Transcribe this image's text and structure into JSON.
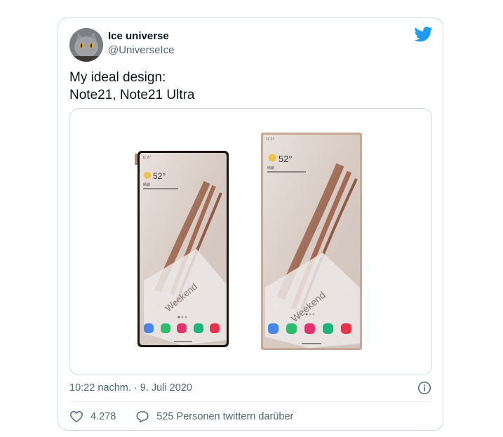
{
  "author": {
    "name": "Ice universe",
    "handle": "@UniverseIce"
  },
  "tweet": {
    "text": "My ideal design:\nNote21, Note21 Ultra"
  },
  "media": {
    "phones": [
      {
        "time": "11:27",
        "temperature": "52°",
        "widget_caption": "晴朗",
        "brand_text": "Weekend",
        "dock_colors": [
          "#4a86e8",
          "#2ebd6b",
          "#e0336f",
          "#20b37c",
          "#e8344a"
        ]
      },
      {
        "time": "11:27",
        "temperature": "52°",
        "widget_caption": "晴朗",
        "brand_text": "Weekend",
        "dock_colors": [
          "#4a86e8",
          "#2ebd6b",
          "#e0336f",
          "#20b37c",
          "#e8344a"
        ]
      }
    ]
  },
  "meta": {
    "timestamp": "10:22 nachm. · 9. Juli 2020"
  },
  "stats": {
    "likes": "4.278",
    "retweets": "525 Personen twittern darüber"
  },
  "colors": {
    "twitter_blue": "#1d9bf0",
    "secondary_text": "#536471",
    "border": "#cfd9de"
  },
  "icons": [
    "twitter-bird-icon",
    "info-icon",
    "heart-icon",
    "speech-bubble-icon"
  ]
}
